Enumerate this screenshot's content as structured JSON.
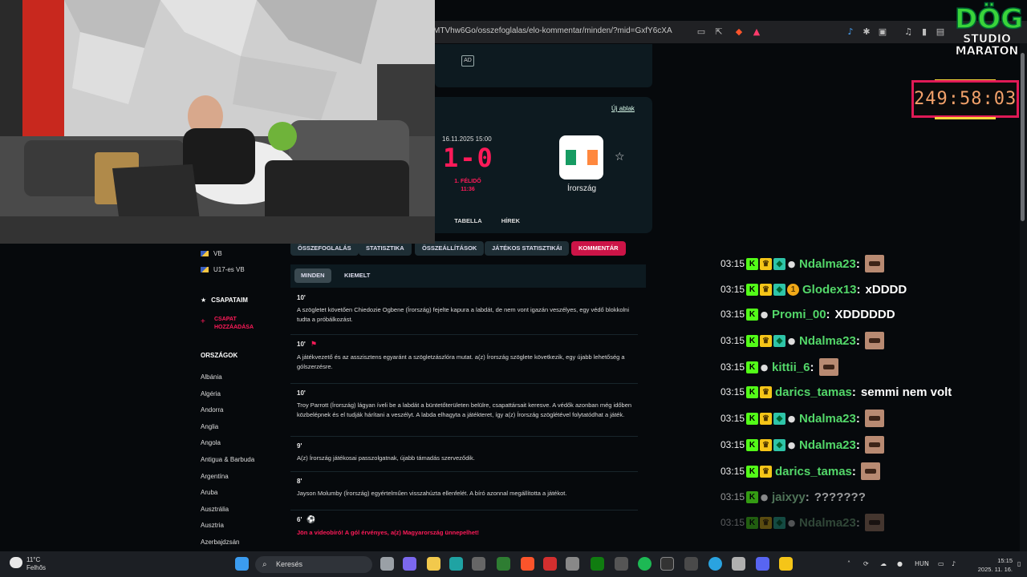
{
  "browser": {
    "url": "MTVhw6Go/osszefoglalas/elo-kommentar/minden/?mid=GxfY6cXA"
  },
  "ad": {
    "label": "AD"
  },
  "match": {
    "new_window": "Új ablak",
    "date": "16.11.2025 15:00",
    "score": "1-0",
    "period_line1": "1. FÉLIDŐ",
    "period_line2": "11:36",
    "team": "Írország",
    "flag_colors": [
      "#169b62",
      "#ffffff",
      "#ff883e"
    ],
    "subnav": [
      "I",
      "TABELLA",
      "HÍREK"
    ]
  },
  "sidebar": {
    "comps": [
      "VB",
      "U17-es VB"
    ],
    "my_teams": "CSAPATAIM",
    "add_team_line1": "CSAPAT",
    "add_team_line2": "HOZZÁADÁSA",
    "countries_head": "ORSZÁGOK",
    "countries": [
      "Albánia",
      "Algéria",
      "Andorra",
      "Anglia",
      "Angola",
      "Antigua & Barbuda",
      "Argentína",
      "Aruba",
      "Ausztrália",
      "Ausztria",
      "Azerbajdzsán"
    ]
  },
  "tabs": [
    "ÖSSZEFOGLALÁS",
    "STATISZTIKA",
    "ÖSSZEÁLLÍTÁSOK",
    "JÁTÉKOS STATISZTIKÁI",
    "KOMMENTÁR"
  ],
  "subtabs": [
    "MINDEN",
    "KIEMELT"
  ],
  "commentary": [
    {
      "minute": "10'",
      "icon": "",
      "text": "A szögletet követően Chiedozie Ogbene (Írország) fejelte kapura a labdát, de nem vont igazán veszélyes, egy védő blokkolni tudta a próbálkozást.",
      "red": false
    },
    {
      "minute": "10'",
      "icon": "⚑",
      "text": "A játékvezető és az asszisztens egyaránt a szögletzászlóra mutat. a(z) Írország szöglete következik, egy újabb lehetőség a gólszerzésre.",
      "red": false
    },
    {
      "minute": "10'",
      "icon": "",
      "text": "Troy Parrott (Írország) lágyan íveli be a labdát a büntetőterületen belülre, csapattársait keresve. A védők azonban még időben közbelépnek és el tudják hárítani a veszélyt. A labda elhagyta a játékteret, így a(z) Írország szöglétével folytatódhat a játék.",
      "red": false
    },
    {
      "minute": "9'",
      "icon": "",
      "text": "A(z) Írország játékosai passzolgatnak, újabb támadás szerveződik.",
      "red": false
    },
    {
      "minute": "8'",
      "icon": "",
      "text": "Jayson Molumby (Írország) egyértelműen visszahúzta ellenfelét. A bíró azonnal megállította a játékot.",
      "red": false
    },
    {
      "minute": "6'",
      "icon": "⚽",
      "text": "Jön a videobíró! A gól érvényes, a(z) Magyarország ünnepelhet!",
      "red": true
    }
  ],
  "chat": [
    {
      "time": "03:15",
      "badges": [
        "k",
        "crown",
        "sub",
        "bomb"
      ],
      "user": "Ndalma23",
      "msg": "",
      "emote": true,
      "faded": false
    },
    {
      "time": "03:15",
      "badges": [
        "k",
        "crown",
        "sub",
        "one"
      ],
      "user": "Glodex13",
      "msg": "xDDDD",
      "emote": false,
      "faded": false
    },
    {
      "time": "03:15",
      "badges": [
        "k",
        "bomb"
      ],
      "user": "Promi_00",
      "msg": "XDDDDDD",
      "emote": false,
      "faded": false
    },
    {
      "time": "03:15",
      "badges": [
        "k",
        "crown",
        "sub",
        "bomb"
      ],
      "user": "Ndalma23",
      "msg": "",
      "emote": true,
      "faded": false
    },
    {
      "time": "03:15",
      "badges": [
        "k",
        "bomb"
      ],
      "user": "kittii_6",
      "msg": "",
      "emote": true,
      "faded": false
    },
    {
      "time": "03:15",
      "badges": [
        "k",
        "crown"
      ],
      "user": "darics_tamas",
      "msg": "semmi nem volt",
      "emote": false,
      "faded": false
    },
    {
      "time": "03:15",
      "badges": [
        "k",
        "crown",
        "sub",
        "bomb"
      ],
      "user": "Ndalma23",
      "msg": "",
      "emote": true,
      "faded": false
    },
    {
      "time": "03:15",
      "badges": [
        "k",
        "crown",
        "sub",
        "bomb"
      ],
      "user": "Ndalma23",
      "msg": "",
      "emote": true,
      "faded": false
    },
    {
      "time": "03:15",
      "badges": [
        "k",
        "crown"
      ],
      "user": "darics_tamas",
      "msg": "",
      "emote": true,
      "faded": false
    },
    {
      "time": "03:15",
      "badges": [
        "k",
        "bomb"
      ],
      "user": "jaixyy",
      "msg": "???????",
      "emote": false,
      "faded": true
    },
    {
      "time": "03:15",
      "badges": [
        "k",
        "crown",
        "sub",
        "bomb"
      ],
      "user": "Ndalma23",
      "msg": "",
      "emote": true,
      "faded": true
    }
  ],
  "overlay": {
    "timer": "249:58:03",
    "logo_big": "DÖG",
    "logo_line2": "STUDIO",
    "logo_line3": "MARATON"
  },
  "taskbar": {
    "temp": "11°C",
    "weather": "Felhős",
    "search": "Keresés",
    "lang": "HUN",
    "time": "15:15",
    "date": "2025. 11. 16."
  }
}
